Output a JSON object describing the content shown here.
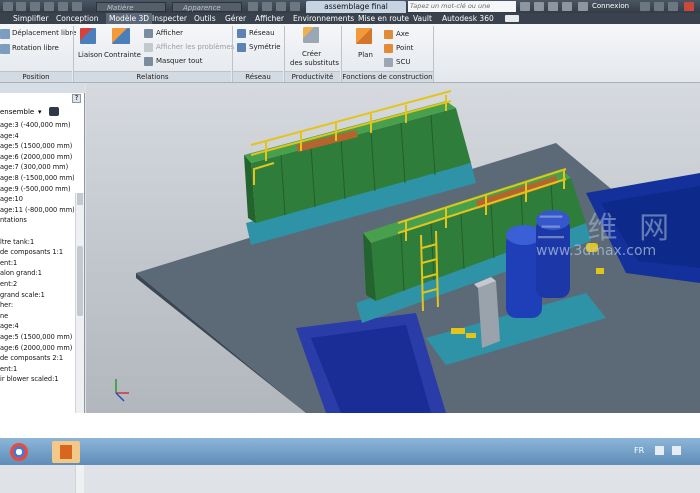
{
  "titlebar": {
    "material_placeholder": "Matière",
    "appearance_placeholder": "Apparence",
    "document_tab": "assemblage final",
    "search_placeholder": "Tapez un mot-clé ou une expression",
    "login": "Connexion"
  },
  "menu": [
    "Simplifier",
    "Conception",
    "Modèle 3D",
    "Inspecter",
    "Outils",
    "Gérer",
    "Afficher",
    "Environnements",
    "Mise en route",
    "Vault",
    "Autodesk 360"
  ],
  "ribbon": {
    "position": {
      "items": [
        "Déplacement libre",
        "Rotation libre"
      ],
      "title": "Position"
    },
    "relations": {
      "liaison": "Liaison",
      "contrainte": "Contrainte",
      "afficher": "Afficher",
      "afficher_problemes": "Afficher les problèmes",
      "masquer_tout": "Masquer tout",
      "title": "Relations"
    },
    "reseau": {
      "reseau": "Réseau",
      "symetrie": "Symétrie",
      "title": "Réseau"
    },
    "productivite": {
      "creer_line1": "Créer",
      "creer_line2": "des substituts",
      "title": "Productivité"
    },
    "construction": {
      "plan": "Plan",
      "axe": "Axe",
      "point": "Point",
      "scu": "SCU",
      "title": "Fonctions de construction"
    }
  },
  "browser": {
    "combo": "ensemble",
    "help": "?",
    "tree": [
      "age:3 (-400,000 mm)",
      "age:4",
      "age:5 (1500,000 mm)",
      "age:6 (2000,000 mm)",
      "age:7 (300,000 mm)",
      "age:8 (-1500,000 mm)",
      "age:9 (-500,000 mm)",
      "age:10",
      "age:11 (-800,000 mm)",
      "ntations",
      "",
      "ltre tank:1",
      "de composants 1:1",
      "ent:1",
      "alon grand:1",
      "ent:2",
      "grand scale:1",
      "her:",
      "ne",
      "age:4",
      "age:5 (1500,000 mm)",
      "age:6 (2000,000 mm)",
      "de composants 2:1",
      "ent:1",
      "ir blower scaled:1"
    ]
  },
  "watermark": {
    "cn": "三 维 网",
    "url": "www.3dmax.com"
  },
  "taskbar": {
    "lang": "FR"
  },
  "colors": {
    "steel": "#2c4a6e",
    "tank_green": "#3f8a3f",
    "railing_yellow": "#e3c41a",
    "floor": "#5a6774",
    "water": "#1a3fbf"
  }
}
